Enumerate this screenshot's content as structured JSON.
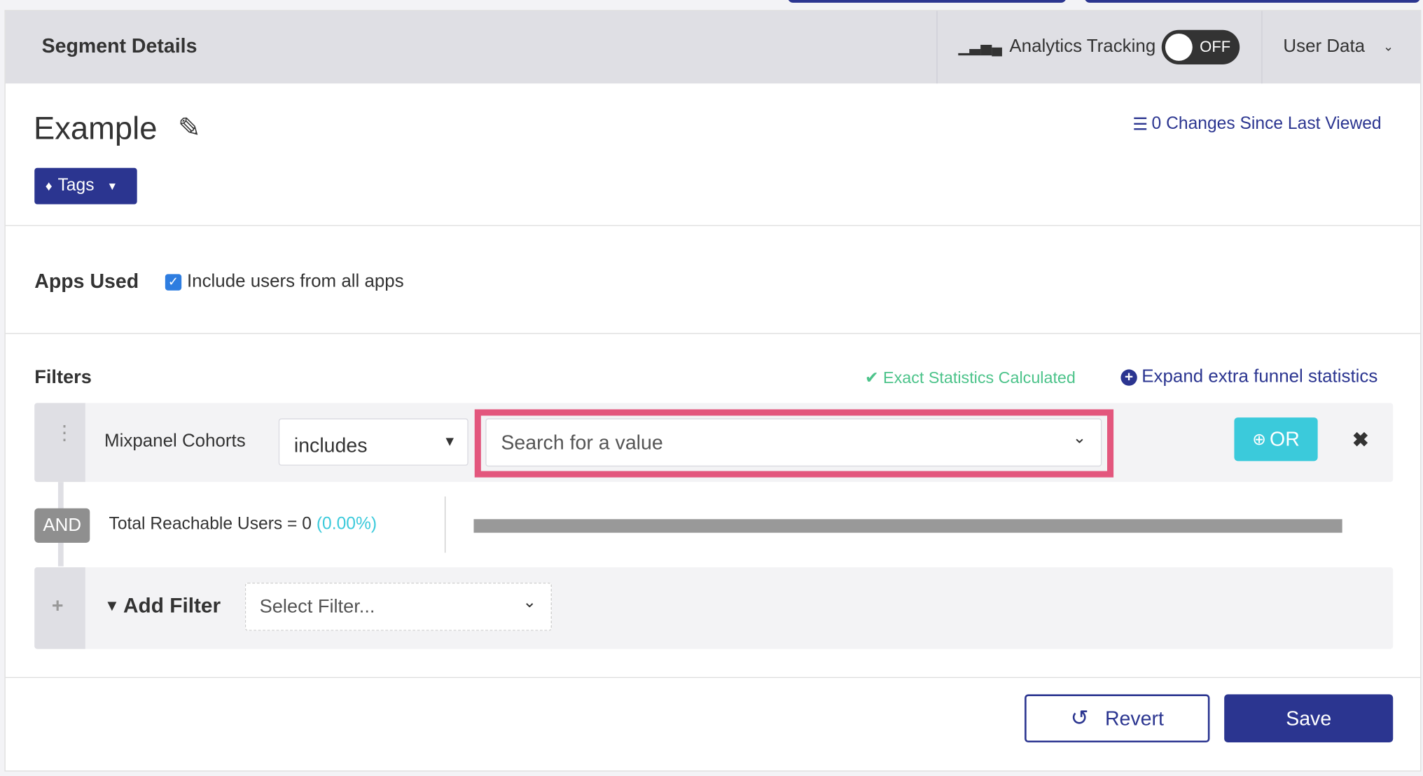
{
  "header": {
    "title": "Segment Details",
    "analytics_label": "Analytics Tracking",
    "toggle_state": "OFF",
    "user_data_label": "User Data"
  },
  "segment": {
    "name": "Example",
    "tags_label": "Tags",
    "changes_link": "0 Changes Since Last Viewed"
  },
  "apps": {
    "label": "Apps Used",
    "checkbox_label": "Include users from all apps",
    "checked": true
  },
  "filters": {
    "label": "Filters",
    "status": "Exact Statistics Calculated",
    "expand_link": "Expand extra funnel statistics",
    "rows": [
      {
        "field": "Mixpanel Cohorts",
        "operator": "includes",
        "value_placeholder": "Search for a value",
        "or_label": "OR"
      }
    ],
    "and_label": "AND",
    "reachable_label": "Total Reachable Users = ",
    "reachable_count": "0",
    "reachable_pct": "(0.00%)",
    "reachable_fraction": 0,
    "add_filter_label": "Add Filter",
    "select_filter_placeholder": "Select Filter..."
  },
  "footer": {
    "revert_label": "Revert",
    "save_label": "Save"
  },
  "colors": {
    "primary": "#2b3590",
    "accent": "#3bcadb",
    "success": "#4cc38a",
    "highlight": "#e3567d"
  }
}
